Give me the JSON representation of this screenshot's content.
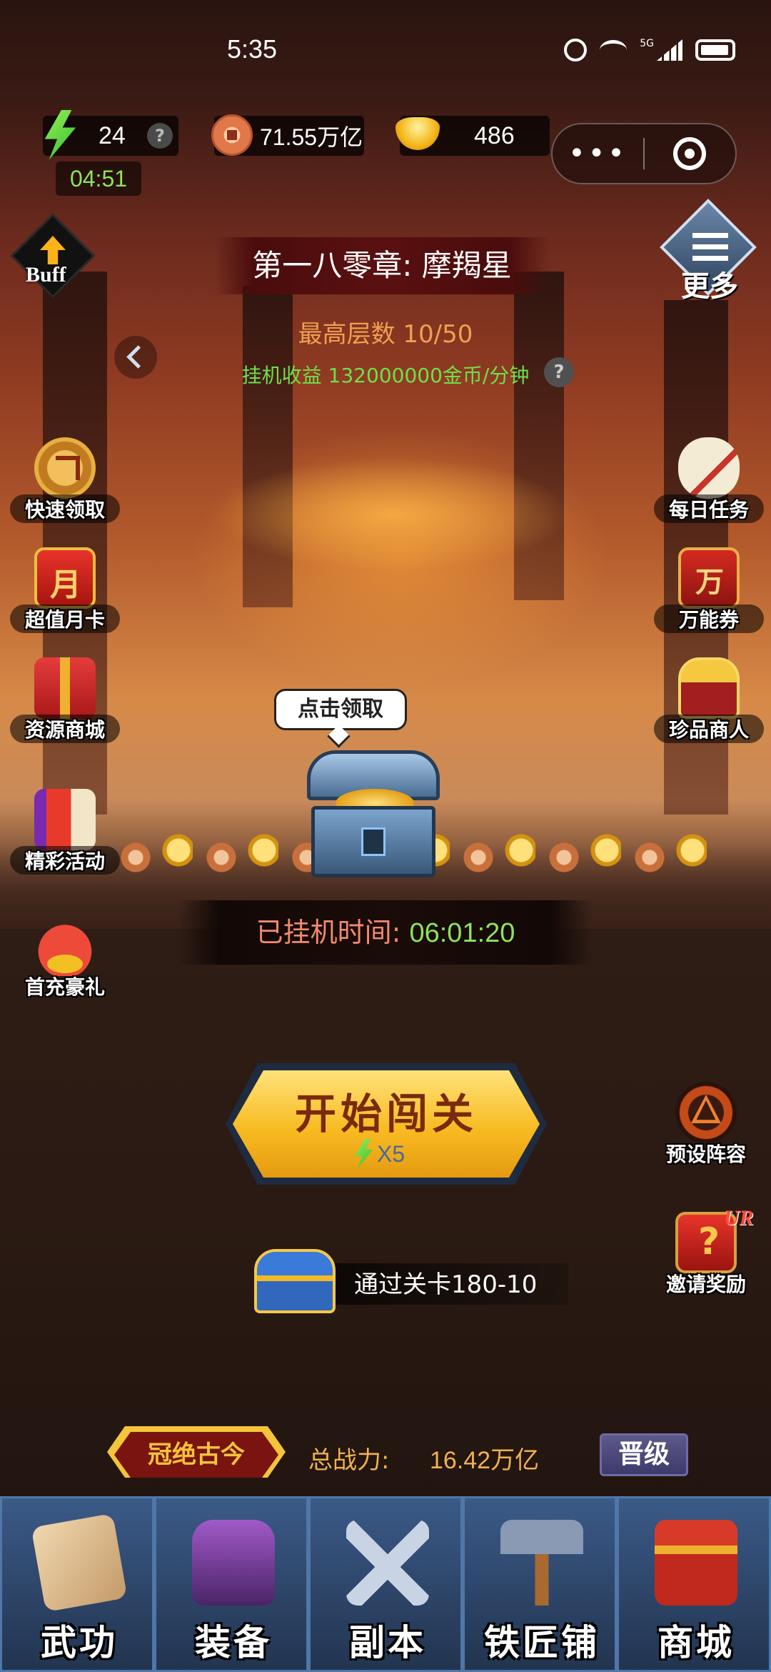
{
  "status_bar": {
    "time": "5:35",
    "network": "5G"
  },
  "resources": {
    "energy": "24",
    "energy_timer": "04:51",
    "copper": "71.55万亿",
    "gold": "486",
    "help": "?"
  },
  "capsule": {
    "more": "•••"
  },
  "buff": {
    "label": "Buff"
  },
  "more_menu": {
    "label": "更多"
  },
  "chapter": {
    "title": "第一八零章: 摩羯星",
    "floor": "最高层数 10/50",
    "income": "挂机收益 132000000金币/分钟",
    "help": "?"
  },
  "left_buttons": [
    {
      "label": "快速领取"
    },
    {
      "label": "超值月卡"
    },
    {
      "label": "资源商城"
    },
    {
      "label": "精彩活动"
    },
    {
      "label": "首充豪礼"
    }
  ],
  "right_buttons": [
    {
      "label": "每日任务"
    },
    {
      "label": "万能券"
    },
    {
      "label": "珍品商人"
    },
    {
      "label": "预设阵容"
    },
    {
      "label": "邀请奖励",
      "tag": "UR"
    }
  ],
  "chest": {
    "bubble": "点击领取"
  },
  "idle": {
    "label": "已挂机时间:",
    "time": "06:01:20"
  },
  "start_button": {
    "title": "开始闯关",
    "cost": "X5"
  },
  "stage_reward": {
    "label": "通过关卡180-10"
  },
  "power": {
    "rank": "冠绝古今",
    "label": "总战力:",
    "value": "16.42万亿",
    "upgrade": "晋级"
  },
  "bottom_nav": [
    {
      "label": "武功",
      "icon": "book-icon"
    },
    {
      "label": "装备",
      "icon": "armor-icon"
    },
    {
      "label": "副本",
      "icon": "swords-icon"
    },
    {
      "label": "铁匠铺",
      "icon": "hammer-icon"
    },
    {
      "label": "商城",
      "icon": "shop-icon"
    }
  ]
}
